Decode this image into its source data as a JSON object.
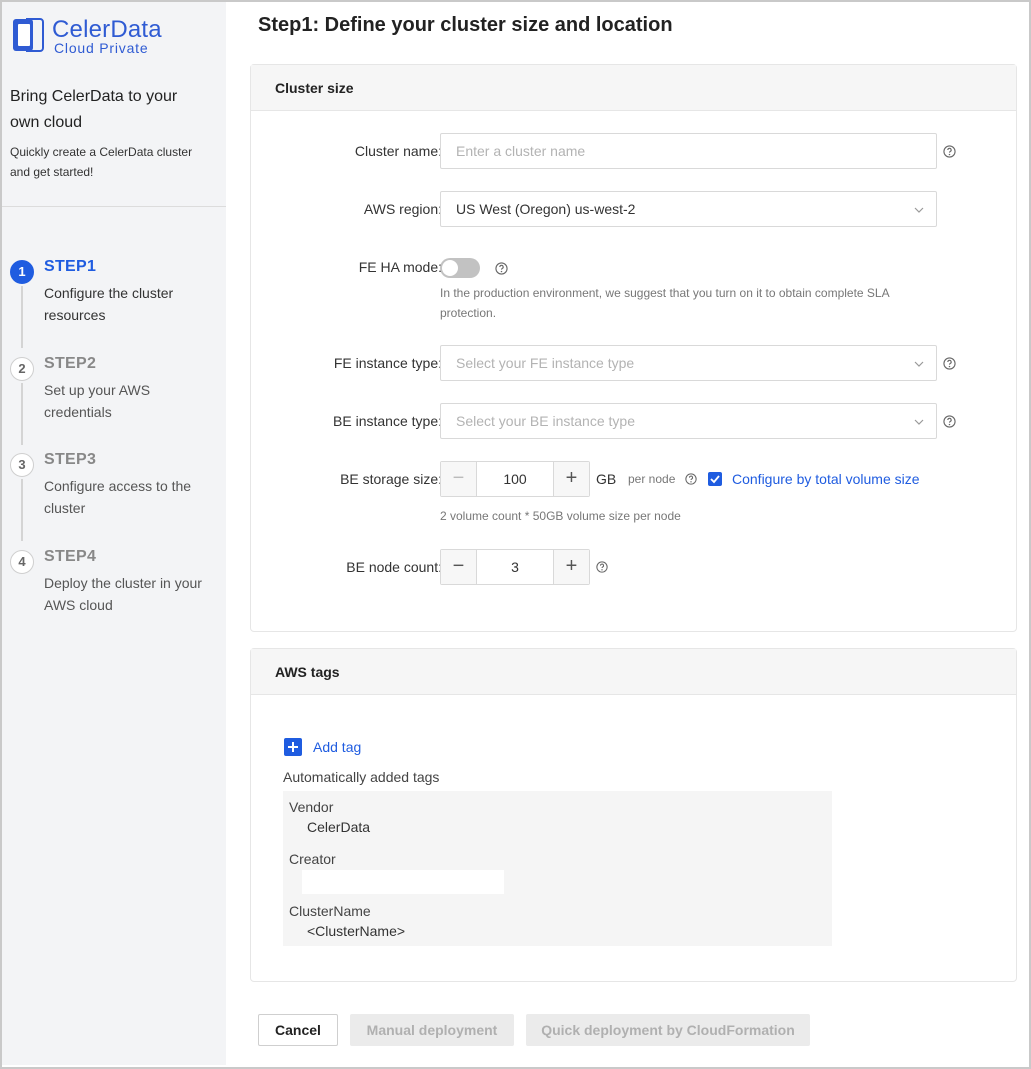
{
  "brand": {
    "name": "CelerData",
    "subtitle": "Cloud Private",
    "color": "#2f5bd3"
  },
  "sidebar": {
    "title": "Bring CelerData to your own cloud",
    "description": "Quickly create a CelerData cluster and get started!",
    "steps": [
      {
        "number": "1",
        "title": "STEP1",
        "description": "Configure the cluster resources",
        "active": true
      },
      {
        "number": "2",
        "title": "STEP2",
        "description": "Set up your AWS credentials",
        "active": false
      },
      {
        "number": "3",
        "title": "STEP3",
        "description": "Configure access to the cluster",
        "active": false
      },
      {
        "number": "4",
        "title": "STEP4",
        "description": "Deploy the cluster in your AWS cloud",
        "active": false
      }
    ]
  },
  "main": {
    "title": "Step1: Define your cluster size and location",
    "cluster_size": {
      "header": "Cluster size",
      "cluster_name": {
        "label": "Cluster name:",
        "value": "",
        "placeholder": "Enter a cluster name"
      },
      "aws_region": {
        "label": "AWS region:",
        "value": "US West (Oregon) us-west-2"
      },
      "fe_ha_mode": {
        "label": "FE HA mode:",
        "enabled": false,
        "note_line1": "In the production environment, we suggest that you turn on it to obtain complete SLA",
        "note_line2": "protection."
      },
      "fe_instance_type": {
        "label": "FE instance type:",
        "placeholder": "Select your FE instance type"
      },
      "be_instance_type": {
        "label": "BE instance type:",
        "placeholder": "Select your BE instance type"
      },
      "be_storage_size": {
        "label": "BE storage size:",
        "value": "100",
        "unit": "GB",
        "per_node": "per node",
        "configure_by_total": "Configure by total volume size",
        "configure_checked": true,
        "note": "2 volume count * 50GB volume size per node"
      },
      "be_node_count": {
        "label": "BE node count:",
        "value": "3"
      }
    },
    "aws_tags": {
      "header": "AWS tags",
      "add_tag": "Add tag",
      "auto_label": "Automatically added tags",
      "tags": [
        {
          "key": "Vendor",
          "value": "CelerData"
        },
        {
          "key": "Creator",
          "value": ""
        },
        {
          "key": "ClusterName",
          "value": "<ClusterName>"
        }
      ]
    },
    "footer": {
      "cancel": "Cancel",
      "manual": "Manual deployment",
      "quick": "Quick deployment by CloudFormation"
    }
  },
  "colors": {
    "accent": "#1f5ce0",
    "sidebar_bg": "#f3f4f6",
    "toggle_off": "#c2c2c2"
  }
}
